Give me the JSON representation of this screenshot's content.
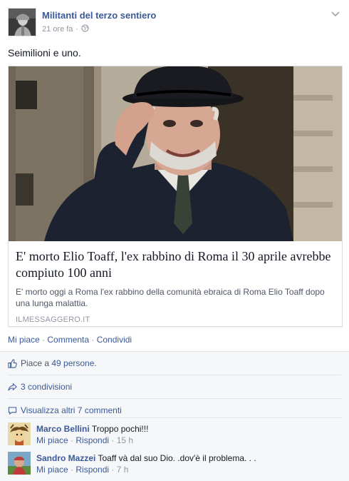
{
  "post": {
    "page_name": "Militanti del terzo sentiero",
    "time": "21 ore fa",
    "separator": "·",
    "text": "Seimilioni e uno."
  },
  "link_card": {
    "title": "E' morto Elio Toaff, l'ex rabbino di Roma il 30 aprile avrebbe compiuto 100 anni",
    "description": "E' morto oggi a Roma l'ex rabbino della comunità ebraica di Roma Elio Toaff dopo una lunga malattia.",
    "source": "ILMESSAGGERO.IT"
  },
  "actions": {
    "like": "Mi piace",
    "comment": "Commenta",
    "share": "Condividi",
    "sep": " · "
  },
  "ufi": {
    "likes_prefix": "Piace a ",
    "likes_count": "49 persone",
    "likes_suffix": ".",
    "shares": "3 condivisioni",
    "view_more": "Visualizza altri 7 commenti"
  },
  "comments": [
    {
      "author": "Marco Bellini",
      "text": "Troppo pochi!!!",
      "like": "Mi piace",
      "reply": "Rispondi",
      "time": "15 h"
    },
    {
      "author": "Sandro Mazzei",
      "text": "Toaff và dal suo Dio. .dov'è il problema. . .",
      "like": "Mi piace",
      "reply": "Rispondi",
      "time": "7 h"
    }
  ],
  "colors": {
    "link": "#3b5998",
    "meta": "#9197a3",
    "ufi_bg": "#f6f7f8"
  },
  "icons": {
    "privacy": "globe-icon",
    "options": "chevron-down-icon",
    "likes": "thumbs-up-icon",
    "shares": "share-arrow-icon",
    "comments": "speech-bubble-icon"
  }
}
